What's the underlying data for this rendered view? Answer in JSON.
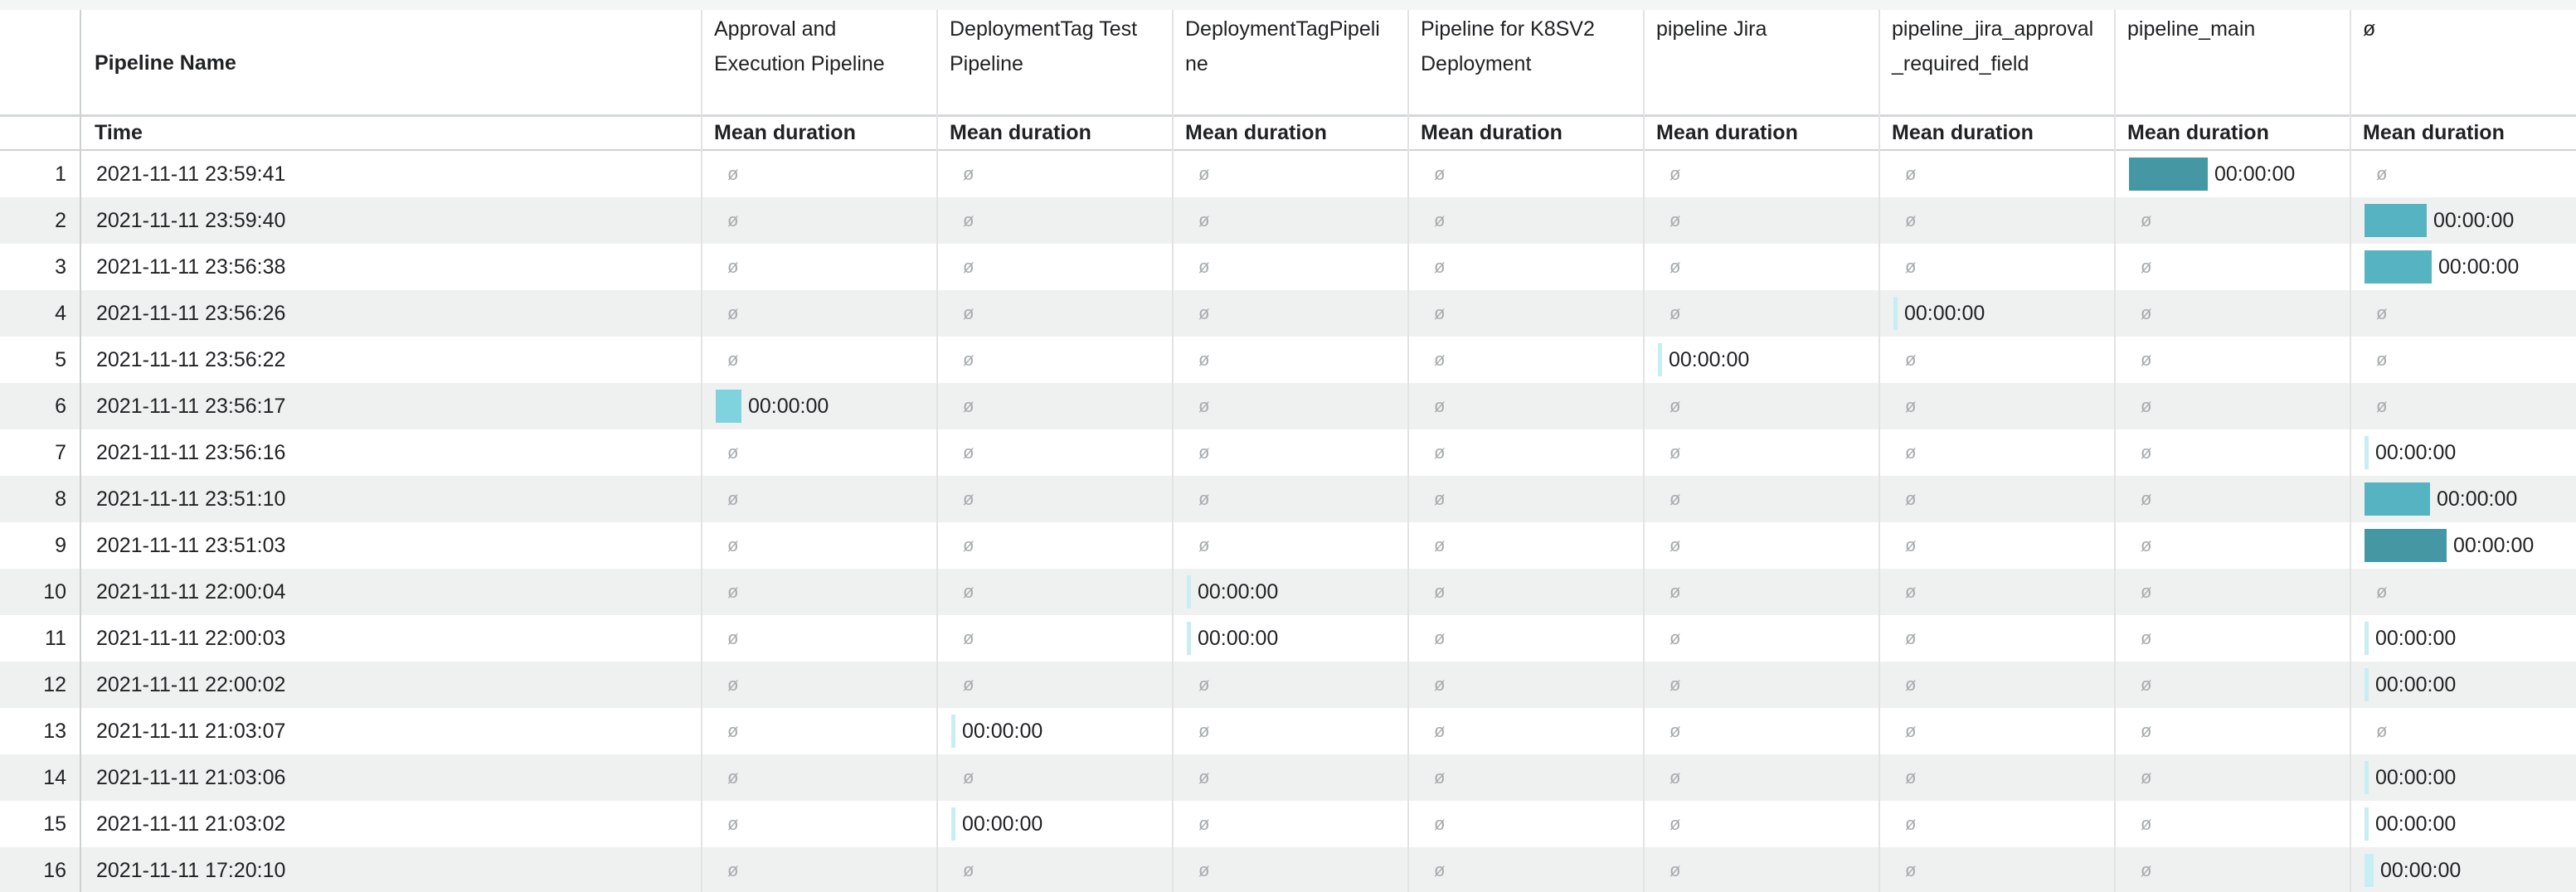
{
  "columns": [
    {
      "name": "Approval and\nExecution Pipeline"
    },
    {
      "name": "DeploymentTag Test\nPipeline"
    },
    {
      "name": "DeploymentTagPipeli\nne"
    },
    {
      "name": "Pipeline for K8SV2\nDeployment"
    },
    {
      "name": "pipeline Jira"
    },
    {
      "name": "pipeline_jira_approval\n_required_field"
    },
    {
      "name": "pipeline_main"
    },
    {
      "name": "ø"
    }
  ],
  "header": {
    "pivot_label": "Pipeline Name",
    "row_label": "Time",
    "measure_label": "Mean duration"
  },
  "null_symbol": "ø",
  "colors": {
    "bar_light": "#c6eef3",
    "bar_mid": "#7fd3de",
    "bar_teal": "#56b3c2",
    "bar_dark": "#4598a3"
  },
  "rows": [
    {
      "index": "1",
      "time": "2021-11-11 23:59:41",
      "cells": [
        null,
        null,
        null,
        null,
        null,
        null,
        {
          "v": "00:00:00",
          "level": 0.86,
          "color": "#4598a3"
        },
        null
      ]
    },
    {
      "index": "2",
      "time": "2021-11-11 23:59:40",
      "cells": [
        null,
        null,
        null,
        null,
        null,
        null,
        null,
        {
          "v": "00:00:00",
          "level": 0.68,
          "color": "#56b3c2"
        }
      ]
    },
    {
      "index": "3",
      "time": "2021-11-11 23:56:38",
      "cells": [
        null,
        null,
        null,
        null,
        null,
        null,
        null,
        {
          "v": "00:00:00",
          "level": 0.74,
          "color": "#56b3c2"
        }
      ]
    },
    {
      "index": "4",
      "time": "2021-11-11 23:56:26",
      "cells": [
        null,
        null,
        null,
        null,
        null,
        {
          "v": "00:00:00",
          "level": 0.04,
          "color": "#c6eef3"
        },
        null,
        null
      ]
    },
    {
      "index": "5",
      "time": "2021-11-11 23:56:22",
      "cells": [
        null,
        null,
        null,
        null,
        {
          "v": "00:00:00",
          "level": 0.04,
          "color": "#c6eef3"
        },
        null,
        null,
        null
      ]
    },
    {
      "index": "6",
      "time": "2021-11-11 23:56:17",
      "cells": [
        {
          "v": "00:00:00",
          "level": 0.28,
          "color": "#7fd3de"
        },
        null,
        null,
        null,
        null,
        null,
        null,
        null
      ]
    },
    {
      "index": "7",
      "time": "2021-11-11 23:56:16",
      "cells": [
        null,
        null,
        null,
        null,
        null,
        null,
        null,
        {
          "v": "00:00:00",
          "level": 0.04,
          "color": "#c6eef3"
        }
      ]
    },
    {
      "index": "8",
      "time": "2021-11-11 23:51:10",
      "cells": [
        null,
        null,
        null,
        null,
        null,
        null,
        null,
        {
          "v": "00:00:00",
          "level": 0.72,
          "color": "#56b3c2"
        }
      ]
    },
    {
      "index": "9",
      "time": "2021-11-11 23:51:03",
      "cells": [
        null,
        null,
        null,
        null,
        null,
        null,
        null,
        {
          "v": "00:00:00",
          "level": 0.9,
          "color": "#4598a3"
        }
      ]
    },
    {
      "index": "10",
      "time": "2021-11-11 22:00:04",
      "cells": [
        null,
        null,
        {
          "v": "00:00:00",
          "level": 0.04,
          "color": "#c6eef3"
        },
        null,
        null,
        null,
        null,
        null
      ]
    },
    {
      "index": "11",
      "time": "2021-11-11 22:00:03",
      "cells": [
        null,
        null,
        {
          "v": "00:00:00",
          "level": 0.04,
          "color": "#c6eef3"
        },
        null,
        null,
        null,
        null,
        {
          "v": "00:00:00",
          "level": 0.04,
          "color": "#c6eef3"
        }
      ]
    },
    {
      "index": "12",
      "time": "2021-11-11 22:00:02",
      "cells": [
        null,
        null,
        null,
        null,
        null,
        null,
        null,
        {
          "v": "00:00:00",
          "level": 0.04,
          "color": "#c6eef3"
        }
      ]
    },
    {
      "index": "13",
      "time": "2021-11-11 21:03:07",
      "cells": [
        null,
        {
          "v": "00:00:00",
          "level": 0.04,
          "color": "#c6eef3"
        },
        null,
        null,
        null,
        null,
        null,
        null
      ]
    },
    {
      "index": "14",
      "time": "2021-11-11 21:03:06",
      "cells": [
        null,
        null,
        null,
        null,
        null,
        null,
        null,
        {
          "v": "00:00:00",
          "level": 0.04,
          "color": "#c6eef3"
        }
      ]
    },
    {
      "index": "15",
      "time": "2021-11-11 21:03:02",
      "cells": [
        null,
        {
          "v": "00:00:00",
          "level": 0.04,
          "color": "#c6eef3"
        },
        null,
        null,
        null,
        null,
        null,
        {
          "v": "00:00:00",
          "level": 0.04,
          "color": "#c6eef3"
        }
      ]
    },
    {
      "index": "16",
      "time": "2021-11-11 17:20:10",
      "cells": [
        null,
        null,
        null,
        null,
        null,
        null,
        null,
        {
          "v": "00:00:00",
          "level": 0.1,
          "color": "#c6eef3"
        }
      ]
    }
  ]
}
